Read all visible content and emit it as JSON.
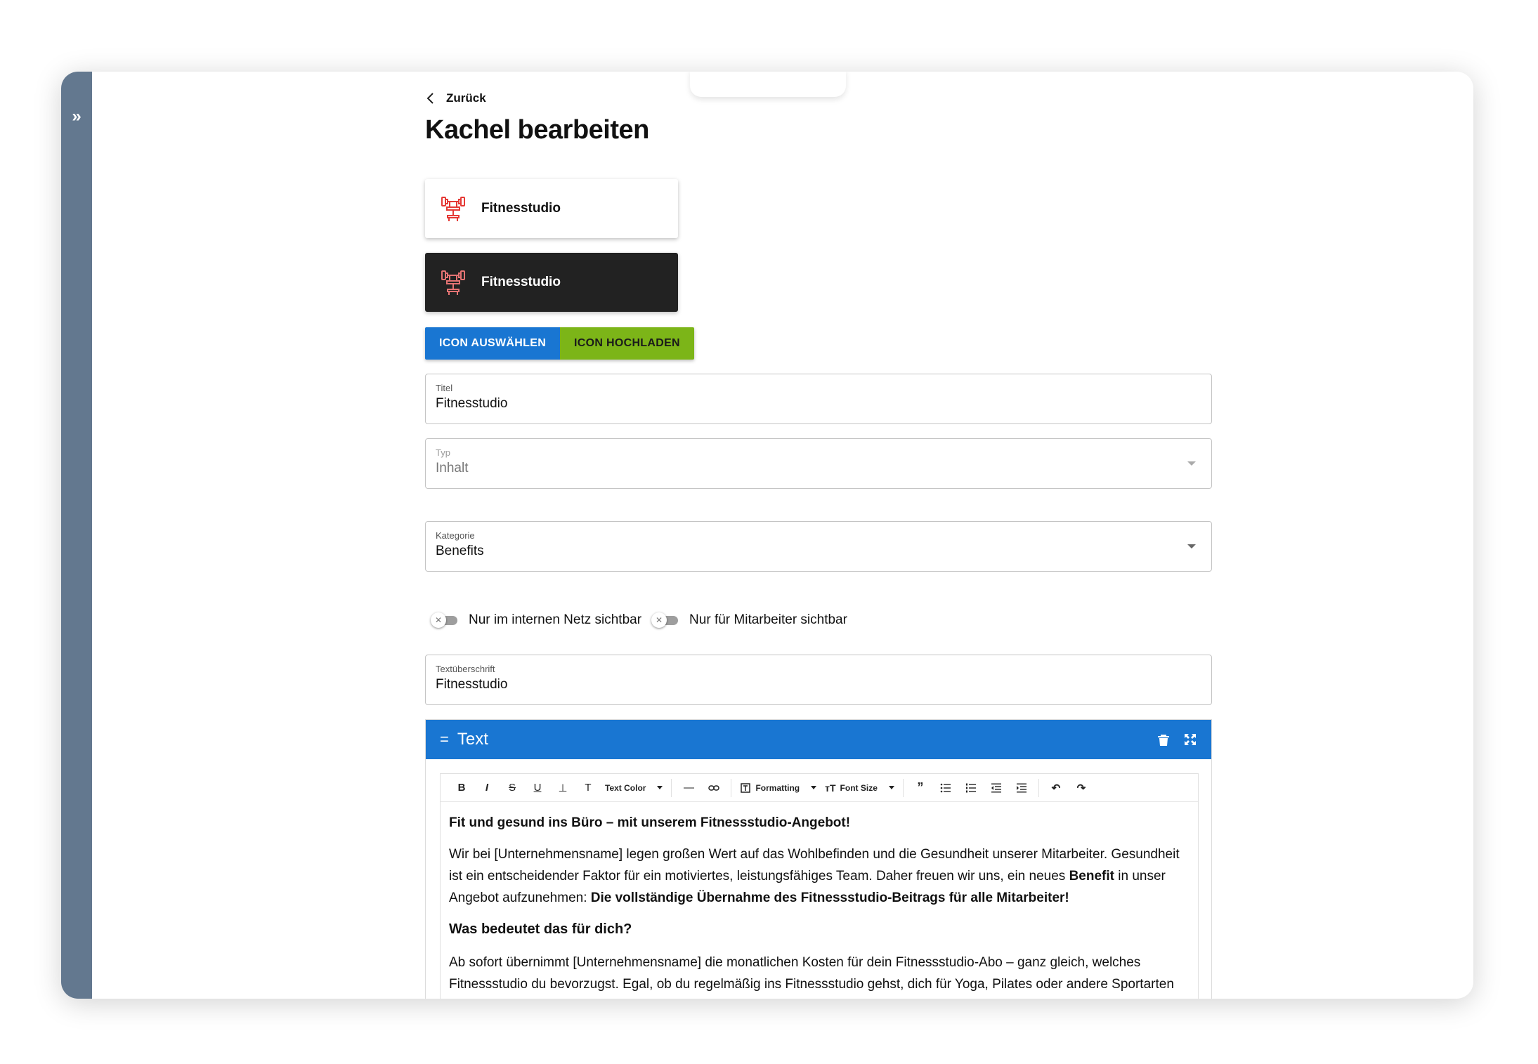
{
  "back": {
    "label": "Zurück"
  },
  "page": {
    "title": "Kachel bearbeiten"
  },
  "rail": {
    "toggle_icon": "»"
  },
  "preview": {
    "light_label": "Fitnesstudio",
    "dark_label": "Fitnesstudio",
    "icon": "dumbbell-bench-icon",
    "icon_color": "#e53935"
  },
  "buttons": {
    "select_icon": "ICON AUSWÄHLEN",
    "upload_icon": "ICON HOCHLADEN"
  },
  "fields": {
    "title": {
      "label": "Titel",
      "value": "Fitnesstudio"
    },
    "type": {
      "label": "Typ",
      "value": "Inhalt"
    },
    "category": {
      "label": "Kategorie",
      "value": "Benefits"
    },
    "text_heading": {
      "label": "Textüberschrift",
      "value": "Fitnesstudio"
    }
  },
  "toggles": {
    "internal_network": {
      "label": "Nur im internen Netz sichtbar",
      "on": false
    },
    "employees_only": {
      "label": "Nur für Mitarbeiter sichtbar",
      "on": false
    }
  },
  "editor": {
    "header_title": "Text",
    "toolbar": {
      "text_color": "Text Color",
      "formatting": "Formatting",
      "font_size": "Font Size"
    },
    "content": {
      "headline": "Fit und gesund ins Büro – mit unserem Fitnessstudio-Angebot!",
      "p1_a": "Wir bei [Unternehmensname] legen großen Wert auf das Wohlbefinden und die Gesundheit unserer Mitarbeiter. Gesundheit ist ein entscheidender Faktor für ein motiviertes, leistungsfähiges Team. Daher freuen wir uns, ein neues ",
      "p1_b": "Benefit",
      "p1_c": " in unser Angebot aufzunehmen: ",
      "p1_d": "Die vollständige Übernahme des Fitnessstudio-Beitrags für alle Mitarbeiter!",
      "subheading": "Was bedeutet das für dich?",
      "p2": "Ab sofort übernimmt [Unternehmensname] die monatlichen Kosten für dein Fitnessstudio-Abo – ganz gleich, welches Fitnessstudio du bevorzugst. Egal, ob du regelmäßig ins Fitnessstudio gehst, dich für Yoga, Pilates oder andere Sportarten"
    }
  },
  "colors": {
    "rail": "#63788f",
    "primary": "#1976d2",
    "accent_green": "#7cb518",
    "dark_tile": "#222222"
  }
}
